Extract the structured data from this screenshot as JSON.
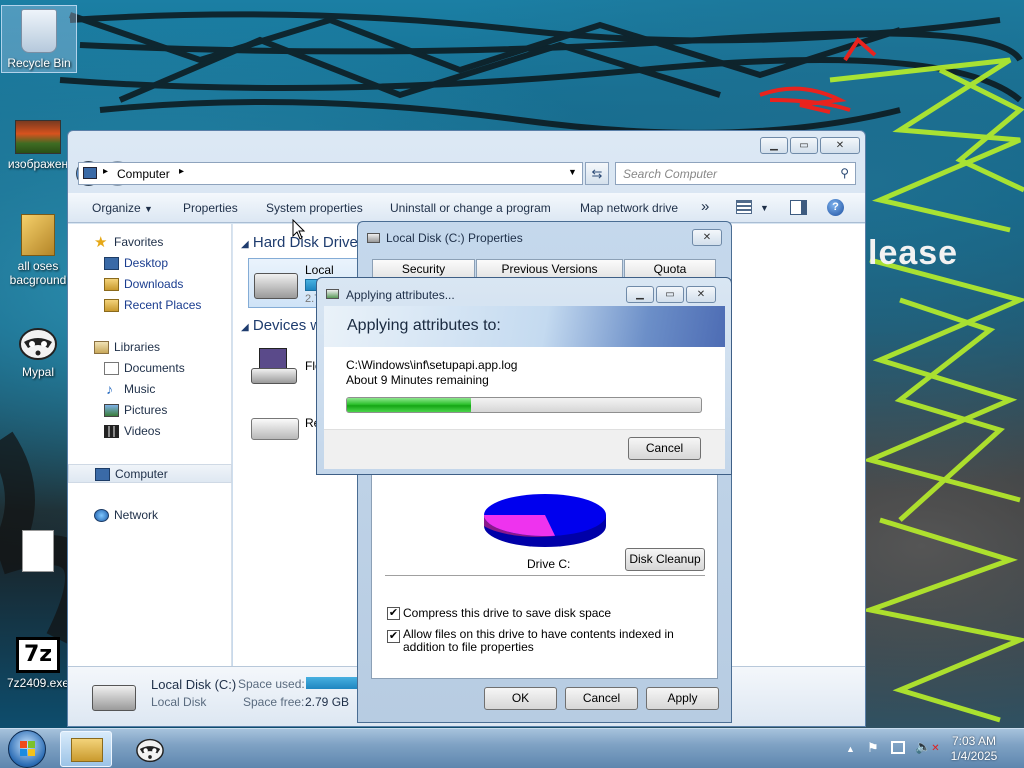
{
  "desktop": {
    "wallpaper_text": "lease",
    "icons": [
      {
        "label": "Recycle Bin"
      },
      {
        "label": "изображен"
      },
      {
        "label": "all oses bacground"
      },
      {
        "label": "Mypal"
      },
      {
        "label": ""
      },
      {
        "label": "7z2409.exe"
      }
    ]
  },
  "explorer": {
    "address_crumb": "Computer",
    "search_placeholder": "Search Computer",
    "toolbar": {
      "organize": "Organize",
      "properties": "Properties",
      "system_properties": "System properties",
      "uninstall": "Uninstall or change a program",
      "map_drive": "Map network drive",
      "more": "»"
    },
    "nav": {
      "favorites": "Favorites",
      "desktop": "Desktop",
      "downloads": "Downloads",
      "recent": "Recent Places",
      "libraries": "Libraries",
      "documents": "Documents",
      "music": "Music",
      "pictures": "Pictures",
      "videos": "Videos",
      "computer": "Computer",
      "network": "Network"
    },
    "groups": {
      "hard_disk": "Hard Disk Drive",
      "devices": "Devices wi"
    },
    "items": {
      "local_disk": "Local Disk",
      "local_disk_size": "2.7",
      "floppy": "Flo",
      "removable": "Re"
    },
    "details": {
      "name": "Local Disk (C:)",
      "type": "Local Disk",
      "space_used_label": "Space used:",
      "space_free_label": "Space free:",
      "space_free_value": "2.79 GB"
    }
  },
  "props_dialog": {
    "title": "Local Disk (C:) Properties",
    "tabs": [
      "Security",
      "Previous Versions",
      "Quota"
    ],
    "drive_label": "Drive C:",
    "disk_cleanup": "Disk Cleanup",
    "compress": "Compress this drive to save disk space",
    "index": "Allow files on this drive to have contents indexed in addition to file properties",
    "compress_checked": true,
    "index_checked": true,
    "ok": "OK",
    "cancel": "Cancel",
    "apply": "Apply",
    "pie": {
      "used_color": "#0000ee",
      "free_color": "#ee33ee",
      "used_fraction": 0.63
    }
  },
  "apply_dialog": {
    "title": "Applying attributes...",
    "heading": "Applying attributes to:",
    "file": "C:\\Windows\\inf\\setupapi.app.log",
    "remaining": "About 9 Minutes remaining",
    "progress": 0.35,
    "cancel": "Cancel"
  },
  "taskbar": {
    "time": "7:03 AM",
    "date": "1/4/2025"
  }
}
